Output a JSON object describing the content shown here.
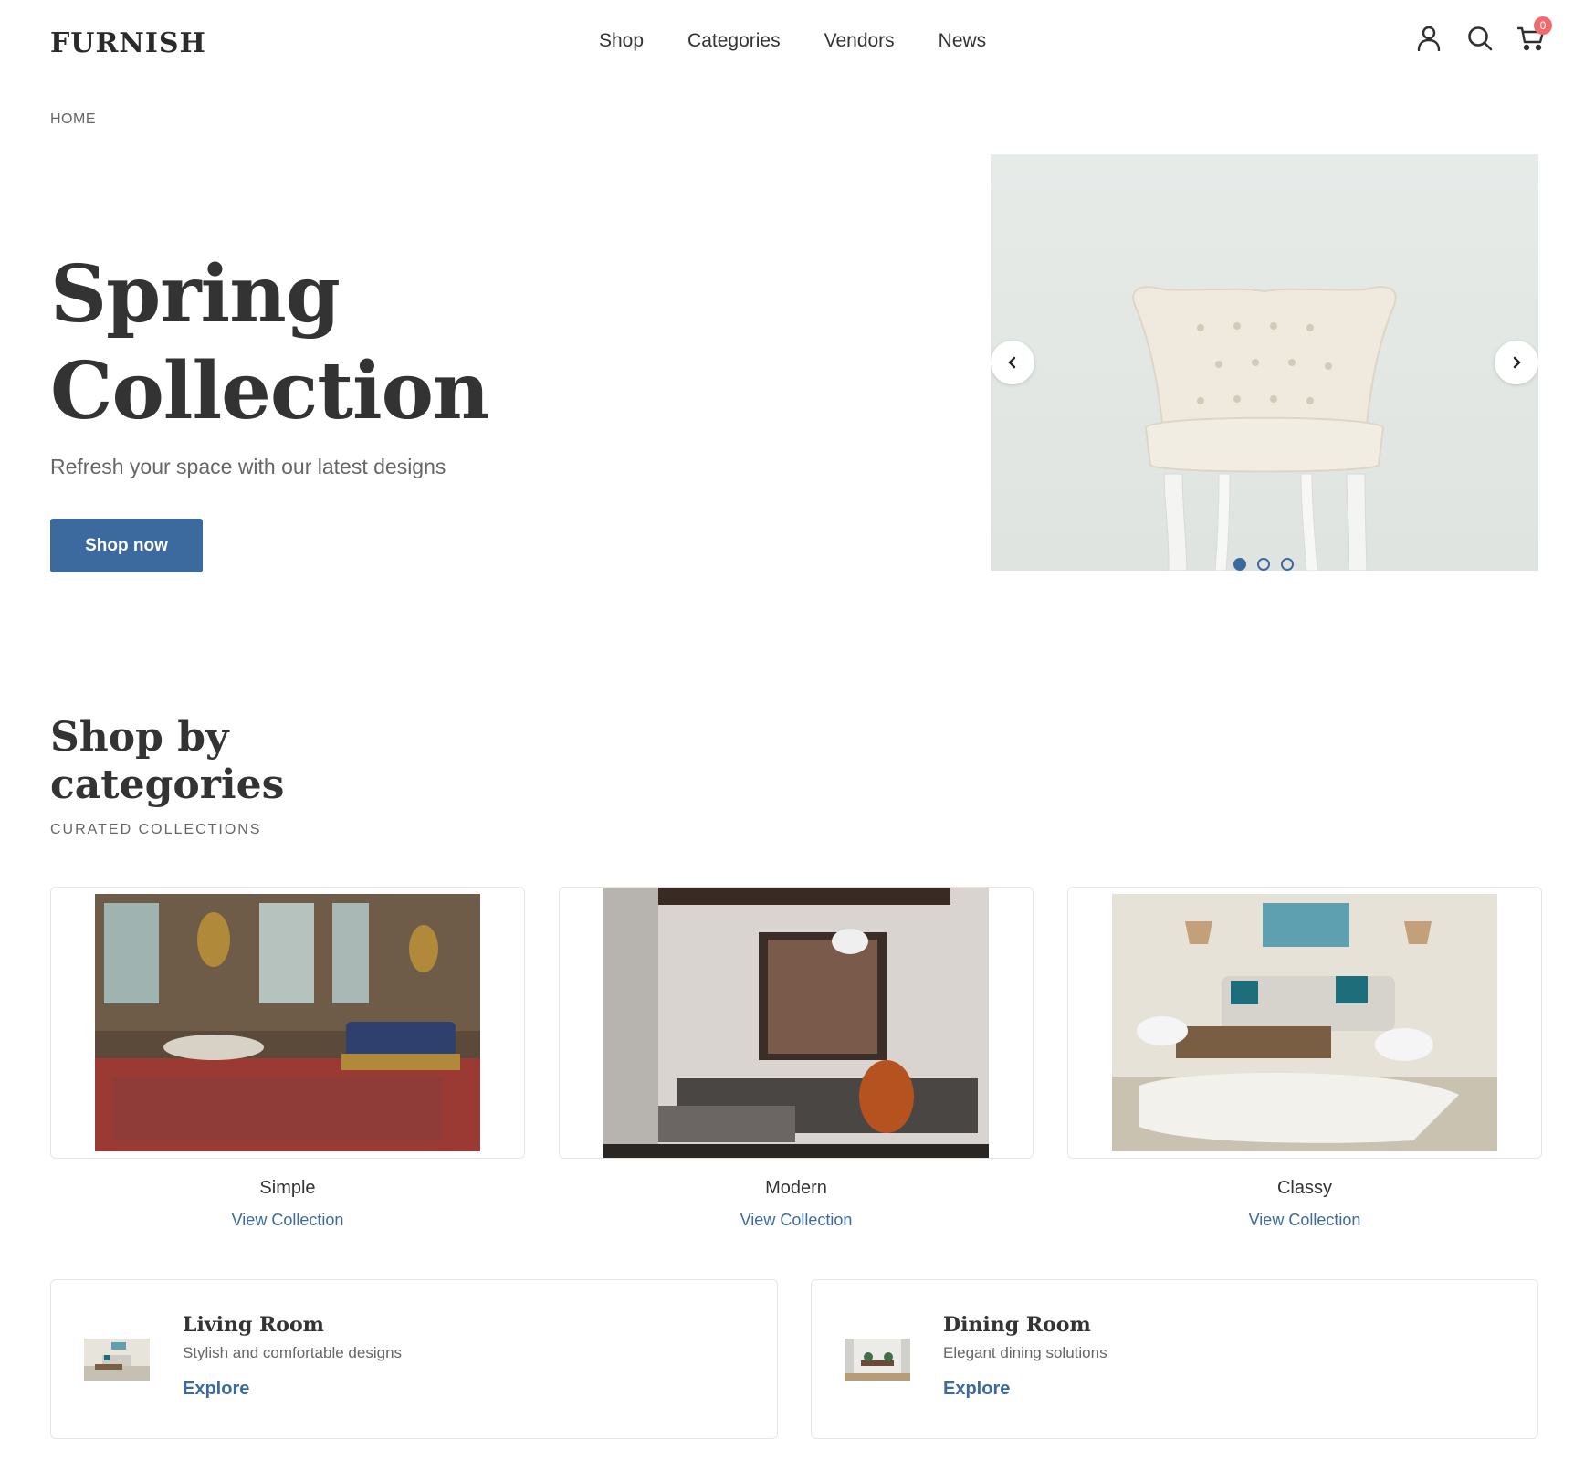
{
  "brand": {
    "logo": "FURNISH"
  },
  "nav": {
    "items": [
      "Shop",
      "Categories",
      "Vendors",
      "News"
    ]
  },
  "header": {
    "cart_count": "0"
  },
  "breadcrumb": "HOME",
  "hero": {
    "title_line1": "Spring",
    "title_line2": "Collection",
    "subtitle": "Refresh your space with our latest designs",
    "cta": "Shop now",
    "slides_total": 3,
    "active_slide": 1
  },
  "categories": {
    "title_line1": "Shop by",
    "title_line2": "categories",
    "subtitle": "CURATED COLLECTIONS",
    "items": [
      {
        "name": "Simple",
        "link": "View Collection"
      },
      {
        "name": "Modern",
        "link": "View Collection"
      },
      {
        "name": "Classy",
        "link": "View Collection"
      }
    ]
  },
  "rooms": [
    {
      "title": "Living Room",
      "desc": "Stylish and comfortable designs",
      "link": "Explore"
    },
    {
      "title": "Dining Room",
      "desc": "Elegant dining solutions",
      "link": "Explore"
    }
  ],
  "colors": {
    "accent": "#3d6a9e",
    "badge": "#f06b6b",
    "text": "#333333",
    "muted": "#666666"
  }
}
